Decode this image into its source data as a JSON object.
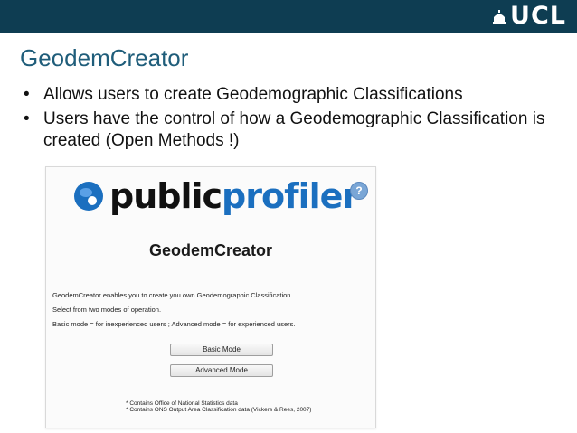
{
  "header": {
    "logo_text": "UCL"
  },
  "slide": {
    "title": "GeodemCreator",
    "bullets": [
      "Allows users to create Geodemographic Classifications",
      "Users have the control of how a Geodemographic Classification is created (Open Methods !)"
    ]
  },
  "screenshot": {
    "logo": {
      "part1": "public",
      "part2": "profiler"
    },
    "help_label": "?",
    "title": "GeodemCreator",
    "description": [
      "GeodemCreator enables you to create you own Geodemographic Classification.",
      "Select from two modes of operation.",
      "Basic mode = for inexperienced users ; Advanced mode = for experienced users."
    ],
    "buttons": {
      "basic": "Basic Mode",
      "advanced": "Advanced Mode"
    },
    "footnotes": [
      "* Contains Office of National Statistics data",
      "* Contains ONS Output Area Classification data (Vickers & Rees, 2007)"
    ]
  },
  "colors": {
    "header_bg": "#0e3d52",
    "title": "#1f5d7a",
    "profiler_blue": "#1b6fbf"
  }
}
